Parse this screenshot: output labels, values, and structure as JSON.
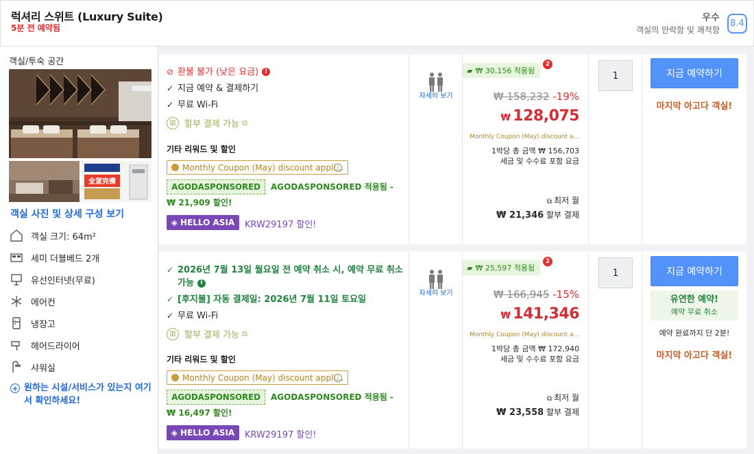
{
  "header": {
    "room_title": "럭셔리 스위트 (Luxury Suite)",
    "booked_note": "5분 전 예약됨",
    "rating_word": "우수",
    "rating_desc": "객실의 안락함 및 쾌적함",
    "rating_score": "8.4"
  },
  "left": {
    "section_title": "객실/투숙 공간",
    "photos_link": "객실 사진 및 상세 구성 보기",
    "amenities": [
      {
        "icon": "room-size-icon",
        "label": "객실 크기: 64m²"
      },
      {
        "icon": "bed-icon",
        "label": "세미 더블베드 2개"
      },
      {
        "icon": "internet-icon",
        "label": "유선인터넷(무료)"
      },
      {
        "icon": "snowflake-icon",
        "label": "에어컨"
      },
      {
        "icon": "fridge-icon",
        "label": "냉장고"
      },
      {
        "icon": "hairdryer-icon",
        "label": "헤어드라이어"
      },
      {
        "icon": "shower-icon",
        "label": "샤워실"
      }
    ],
    "more_link": "원하는 시설/서비스가 있는지 여기서 확인하세요!",
    "photo_text": "全室完備"
  },
  "offers": [
    {
      "conditions": [
        {
          "icon": "no-refund-icon",
          "text": "환불 불가 (낮은 요금)",
          "style": "red",
          "info": true
        },
        {
          "icon": "check-icon",
          "text": "지금 예약 & 결제하기",
          "style": "plain"
        },
        {
          "icon": "check-icon",
          "text": "무료 Wi-Fi",
          "style": "plain"
        }
      ],
      "installment": "할부 결제 가능",
      "other_title": "기타 리워드 및 할인",
      "coupon": "Monthly Coupon (May) discount appli...",
      "agoda_tag": "AGODASPONSORED",
      "agoda_text": "AGODASPONSORED 적용됨 - ₩ 21,909 할인!",
      "hello_tag": "HELLO ASIA",
      "hello_text": "KRW29197 할인!",
      "detail_link": "자세히 보기",
      "saving": "₩ 30,156 적용됨",
      "saving_badge": "2",
      "original_price": "₩ 158,232",
      "discount_pct": "-19%",
      "currency": "₩",
      "final_price": "128,075",
      "coupon_small": "Monthly Coupon (May) discount a...",
      "per_night_1": "1박당 총 금액 ₩ 156,703",
      "per_night_2": "세금 및 수수료 포함 요금",
      "monthly_label": "최저 월",
      "monthly_amount": "₩ 21,346",
      "monthly_suffix": "할부 결제",
      "qty": "1",
      "book_btn": "지금 예약하기",
      "last_room": "마지막 아고다 객실!"
    },
    {
      "conditions": [
        {
          "icon": "check-icon",
          "text": "2026년 7월 13일 월요일 전 예약 취소 시, 예약 무료 취소 가능",
          "style": "green",
          "info": true
        },
        {
          "icon": "check-icon",
          "text": "[후지불] 자동 결제일: 2026년 7월 11일 토요일",
          "style": "green"
        },
        {
          "icon": "check-icon",
          "text": "무료 Wi-Fi",
          "style": "plain"
        }
      ],
      "installment": "할부 결제 가능",
      "other_title": "기타 리워드 및 할인",
      "coupon": "Monthly Coupon (May) discount appli...",
      "agoda_tag": "AGODASPONSORED",
      "agoda_text": "AGODASPONSORED 적용됨 - ₩ 16,497 할인!",
      "hello_tag": "HELLO ASIA",
      "hello_text": "KRW29197 할인!",
      "detail_link": "자세히 보기",
      "saving": "₩ 25,597 적용됨",
      "saving_badge": "2",
      "original_price": "₩ 166,945",
      "discount_pct": "-15%",
      "currency": "₩",
      "final_price": "141,346",
      "coupon_small": "Monthly Coupon (May) discount a...",
      "per_night_1": "1박당 총 금액 ₩ 172,940",
      "per_night_2": "세금 및 수수료 포함 요금",
      "monthly_label": "최저 월",
      "monthly_amount": "₩ 23,558",
      "monthly_suffix": "할부 결제",
      "qty": "1",
      "book_btn": "지금 예약하기",
      "flex_title": "유연한 예약!",
      "flex_sub": "예약 무료 취소",
      "left_count": "예약 완료까지 단 2분!",
      "last_room": "마지막 아고다 객실!"
    }
  ]
}
